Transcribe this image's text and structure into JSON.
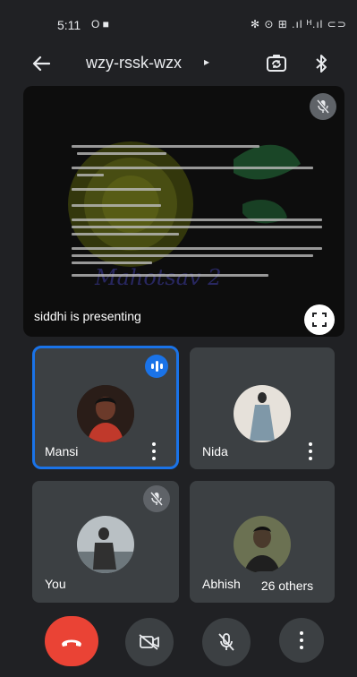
{
  "status_bar": {
    "time": "5:11",
    "left_icons": "O ■",
    "right_icons": "✻ ⊙ ⊞ .ıl ᴴ.ıl ⊂⊃"
  },
  "header": {
    "meeting_code": "wzy-rssk-wzx",
    "caret": "▸"
  },
  "presentation": {
    "presenter_label": "siddhi is presenting"
  },
  "participants": [
    {
      "name": "Mansi",
      "speaking": true,
      "avatar_color": "#6b3a2a"
    },
    {
      "name": "Nida",
      "speaking": false,
      "avatar_color": "#c8c4bd"
    },
    {
      "name": "You",
      "muted": true,
      "avatar_color": "#7f8a8f"
    },
    {
      "name": "Abhish",
      "muted": false,
      "avatar_color": "#4a4f3c"
    }
  ],
  "others_label": "26 others",
  "colors": {
    "accent": "#1a73e8",
    "end_call": "#ea4335",
    "tile_bg": "#3c4043",
    "page_bg": "#202124"
  }
}
